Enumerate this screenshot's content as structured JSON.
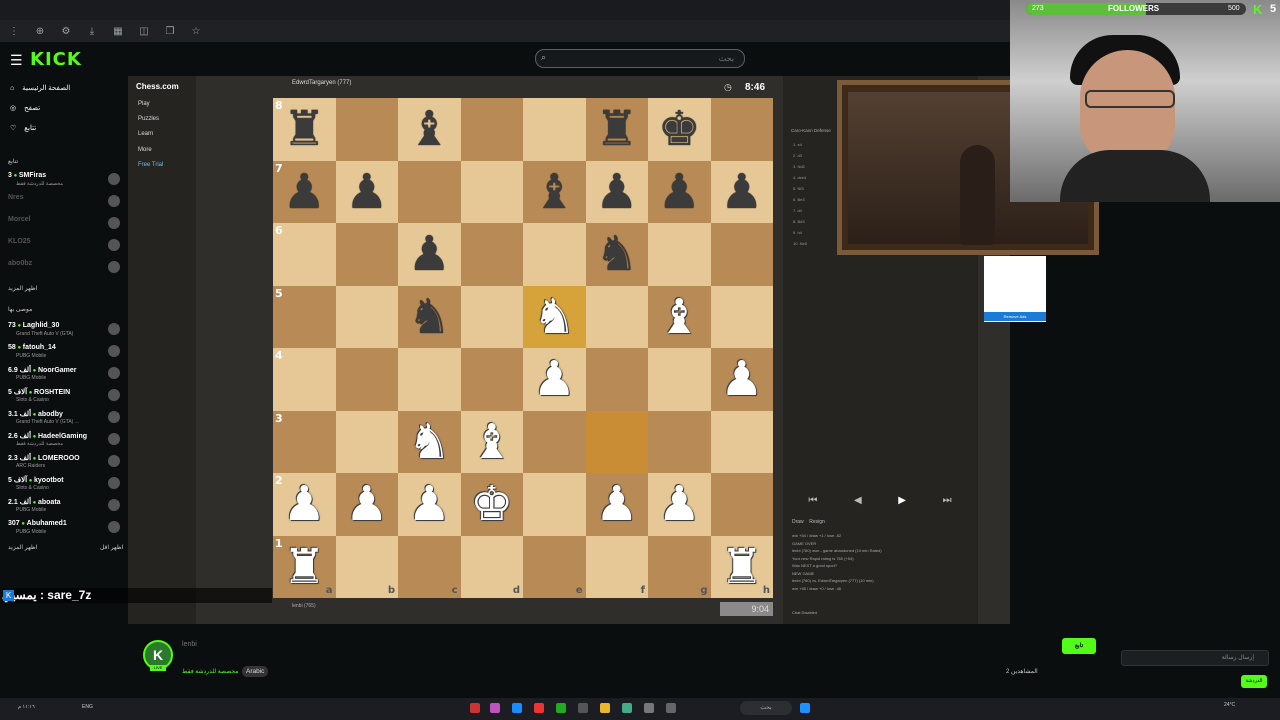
{
  "search": {
    "placeholder": "بحث"
  },
  "nav": {
    "home": "الصفحة الرئيسية",
    "browse": "تصفح",
    "following": "تتابع"
  },
  "sidebar": {
    "following_title": "تتابع",
    "channels": [
      {
        "viewers": "3",
        "name": "SMFiras",
        "game": "مخصصة للدردشة فقط"
      },
      {
        "viewers": "",
        "name": "Nres",
        "game": ""
      },
      {
        "viewers": "",
        "name": "Morcel",
        "game": ""
      },
      {
        "viewers": "",
        "name": "KLO25",
        "game": ""
      },
      {
        "viewers": "",
        "name": "abo0bz",
        "game": ""
      }
    ],
    "show_more": "اظهر المزيد",
    "recommended_title": "موصى بها",
    "recommended": [
      {
        "viewers": "73",
        "name": "Laghlid_30",
        "game": "Grand Theft Auto V (GTA)"
      },
      {
        "viewers": "58",
        "name": "fatouh_14",
        "game": "PUBG Mobile"
      },
      {
        "viewers": "6.9 ألف",
        "name": "NoorGamer",
        "game": "PUBG Mobile"
      },
      {
        "viewers": "5 آلاف",
        "name": "ROSHTEIN",
        "game": "Slots & Casino"
      },
      {
        "viewers": "3.1 ألف",
        "name": "abodby",
        "game": "Grand Theft Auto V (GTA) ..."
      },
      {
        "viewers": "2.6 ألف",
        "name": "HadeelGaming",
        "game": "مخصصة للدردشة فقط"
      },
      {
        "viewers": "2.3 ألف",
        "name": "LOMEROOO",
        "game": "ARC Raiders"
      },
      {
        "viewers": "5 آلاف",
        "name": "kyootbot",
        "game": "Slots & Casino"
      },
      {
        "viewers": "2.1 ألف",
        "name": "aboata",
        "game": "PUBG Mobile"
      },
      {
        "viewers": "307",
        "name": "Abuhamed1",
        "game": "PUBG Mobile"
      }
    ],
    "show_more2": "اظهر المزيد",
    "show_less": "اظهر اقل"
  },
  "chess": {
    "logo": "Chess.com",
    "menu": [
      "Play",
      "Puzzles",
      "Learn",
      "More",
      "Free Trial"
    ],
    "opponent": "EdwrdTargaryen (777)",
    "opponent_clock": "8:46",
    "me": "lenbi (765)",
    "my_clock": "9:04",
    "opening": "Caro-Kann Defense",
    "moves": [
      "1. e4",
      "2. d3",
      "3. Nd2",
      "4. dxe4",
      "5. Nf3",
      "6. Be3",
      "7. d4",
      "8. Bd3",
      "9. h4",
      "10. Ne5"
    ],
    "actions": [
      "Draw",
      "Resign"
    ],
    "result_lines": [
      "win +54 / draw +1 / lose -52",
      "GAME OVER",
      "lenbi (760) won - game abandoned (10 min Rated)",
      "Your new Rapid rating is 760 (+54)",
      "Was NEXT a good sport?",
      "NEW GAME",
      "lenbi (760) vs. EdwrdTargaryen (777) (10 min)",
      "win +45 / draw +0 / lose -46"
    ],
    "chat_disabled": "Chat Disabled",
    "ranks": [
      "8",
      "7",
      "6",
      "5",
      "4",
      "3",
      "2",
      "1"
    ],
    "files": [
      "a",
      "b",
      "c",
      "d",
      "e",
      "f",
      "g",
      "h"
    ],
    "board": [
      [
        "bR",
        "",
        "bB",
        "",
        "",
        "bR",
        "bK",
        ""
      ],
      [
        "bP",
        "bP",
        "",
        "",
        "bB",
        "bP",
        "bP",
        "bP"
      ],
      [
        "",
        "",
        "bP",
        "",
        "",
        "bN",
        "",
        ""
      ],
      [
        "",
        "",
        "bN",
        "",
        "wN",
        "",
        "wB",
        ""
      ],
      [
        "",
        "",
        "",
        "",
        "wP",
        "",
        "",
        "wP"
      ],
      [
        "",
        "",
        "wN",
        "wB",
        "",
        "",
        "",
        ""
      ],
      [
        "wP",
        "wP",
        "wP",
        "wK",
        "",
        "wP",
        "wP",
        ""
      ],
      [
        "wR",
        "",
        "",
        "",
        "",
        "",
        "",
        "wR"
      ]
    ]
  },
  "ads": {
    "remove": "Remove Ads"
  },
  "overlay": {
    "followers_label": "FOLLOWERS",
    "followers_current": "273",
    "followers_goal": "500",
    "followers_fraction": 0.546,
    "k": "K",
    "num": "5"
  },
  "chat": {
    "message": "sare_7z : يمسيي",
    "input_placeholder": "إرسال رسالة",
    "send": "الدردشة"
  },
  "channel": {
    "name": "lenbi",
    "category": "مخصصة للدردشة فقط",
    "language": "Arabic",
    "follow": "تابع",
    "viewers": "المشاهدين 2",
    "live": "LIVE"
  },
  "taskbar": {
    "search": "بحث",
    "lang": "ENG",
    "time": "24°C",
    "left_text": "١١:١٦ م"
  },
  "colors": {
    "kick_green": "#53fc18",
    "board_light": "#e6c896",
    "board_dark": "#b88a56"
  }
}
